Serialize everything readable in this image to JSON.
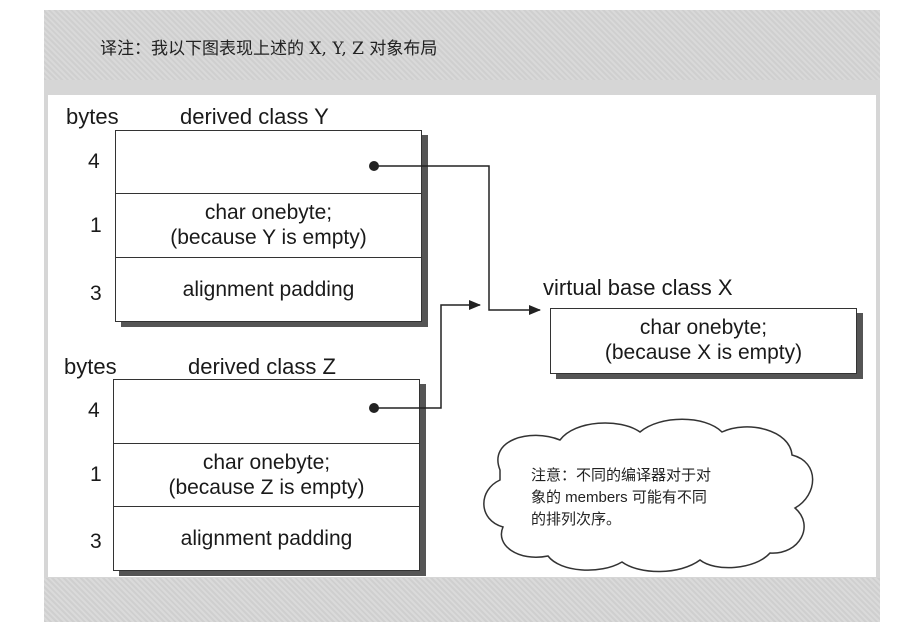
{
  "header": {
    "caption": "译注：我以下图表现上述的 X, Y, Z 对象布局"
  },
  "class_y": {
    "bytes_label": "bytes",
    "title": "derived class Y",
    "rows": [
      {
        "bytes": "4",
        "text": ""
      },
      {
        "bytes": "1",
        "text_line1": "char onebyte;",
        "text_line2": "(because  Y  is  empty)"
      },
      {
        "bytes": "3",
        "text": "alignment padding"
      }
    ]
  },
  "class_z": {
    "bytes_label": "bytes",
    "title": "derived class Z",
    "rows": [
      {
        "bytes": "4",
        "text": ""
      },
      {
        "bytes": "1",
        "text_line1": "char onebyte;",
        "text_line2": "(because  Z  is  empty)"
      },
      {
        "bytes": "3",
        "text": "alignment padding"
      }
    ]
  },
  "class_x": {
    "title": "virtual  base  class  X",
    "text_line1": "char onebyte;",
    "text_line2": "(because  X  is  empty)"
  },
  "note": {
    "line1": "注意：不同的编译器对于对",
    "line2": "象的 members 可能有不同",
    "line3": "的排列次序。"
  }
}
